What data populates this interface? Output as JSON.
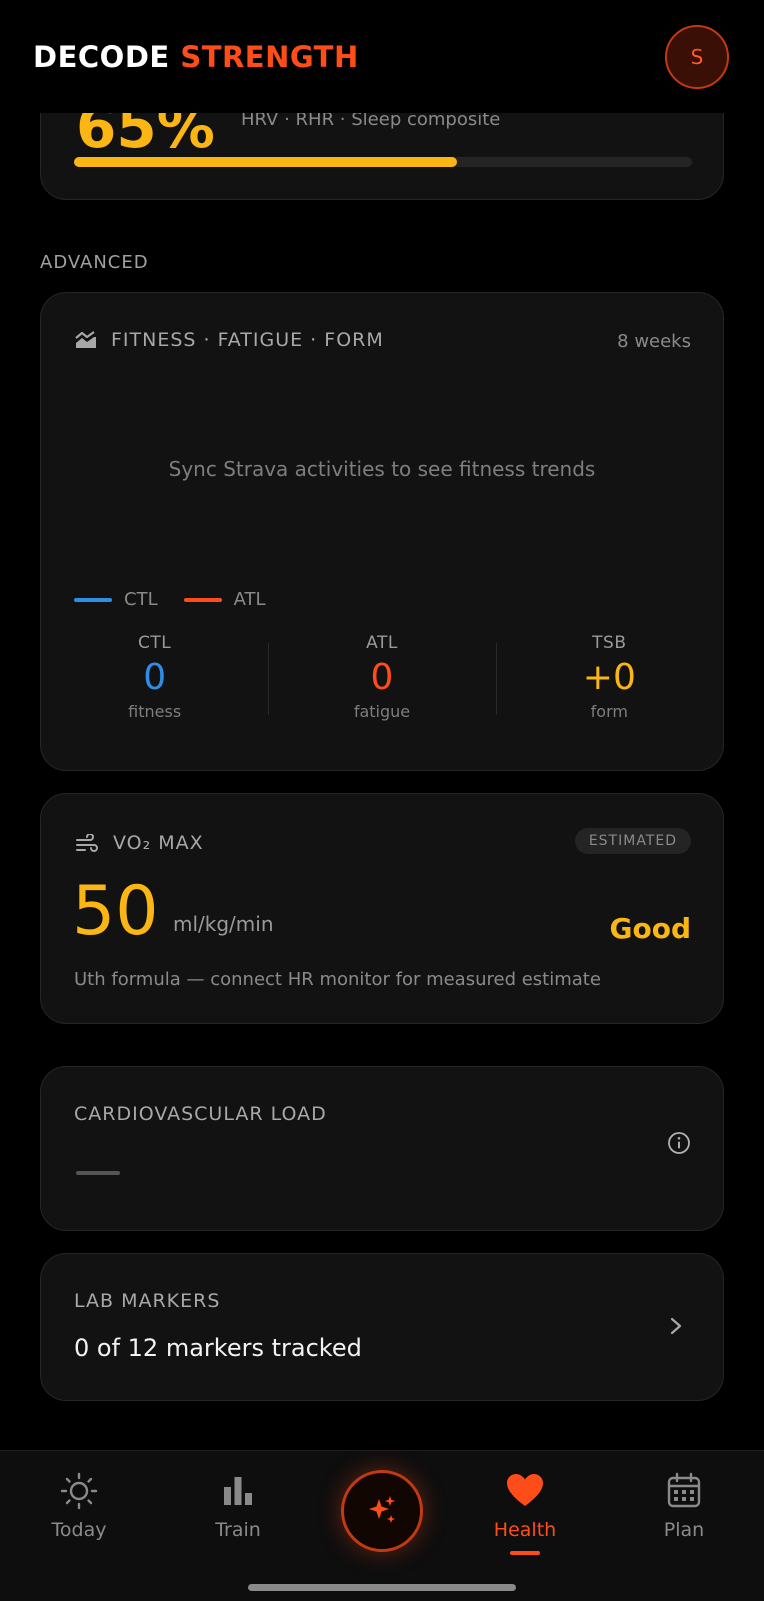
{
  "header": {
    "brand_word1": "DECODE",
    "brand_word2": "STRENGTH",
    "avatar_initial": "S"
  },
  "readiness": {
    "value_fragment": "65%",
    "subtitle": "HRV · RHR · Sleep composite",
    "progress_percent": 62
  },
  "section_advanced": "ADVANCED",
  "fitness": {
    "title": "FITNESS · FATIGUE · FORM",
    "range": "8 weeks",
    "empty_message": "Sync Strava activities to see fitness trends",
    "legend": [
      {
        "label": "CTL",
        "color": "#2f8de4"
      },
      {
        "label": "ATL",
        "color": "#ff4d1a"
      }
    ],
    "stats": [
      {
        "label": "CTL",
        "value": "0",
        "sub": "fitness",
        "color": "#2f8de4"
      },
      {
        "label": "ATL",
        "value": "0",
        "sub": "fatigue",
        "color": "#ff4d1a"
      },
      {
        "label": "TSB",
        "value": "+0",
        "sub": "form",
        "color": "#fbb614"
      }
    ]
  },
  "vo2": {
    "title": "VO₂ MAX",
    "badge": "ESTIMATED",
    "value": "50",
    "unit": "ml/kg/min",
    "rating": "Good",
    "note": "Uth formula — connect HR monitor for measured estimate"
  },
  "cardio": {
    "title": "CARDIOVASCULAR LOAD",
    "value": "—"
  },
  "lab": {
    "title": "LAB MARKERS",
    "value": "0 of 12 markers tracked"
  },
  "nav": {
    "items": [
      {
        "label": "Today",
        "icon": "sun-icon"
      },
      {
        "label": "Train",
        "icon": "bar-chart-icon"
      },
      {
        "label": "Health",
        "icon": "heart-icon"
      },
      {
        "label": "Plan",
        "icon": "calendar-icon"
      }
    ],
    "active": "Health"
  },
  "colors": {
    "accent": "#ff4d1a",
    "gold": "#fbb614",
    "blue": "#2f8de4"
  }
}
